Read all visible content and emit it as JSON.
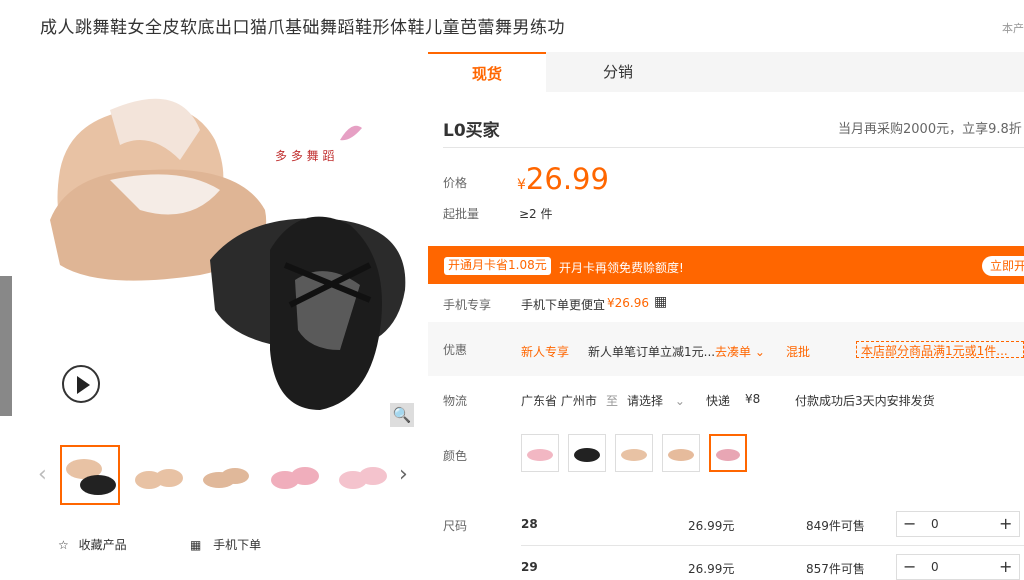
{
  "title": "成人跳舞鞋女全皮软底出口猫爪基础舞蹈鞋形体鞋儿童芭蕾舞男练功",
  "top_right": "本产",
  "tabs": [
    "现货",
    "分销"
  ],
  "buyer_level": "L0买家",
  "buyer_tip": "当月再采购2000元，立享9.8折",
  "price_label": "价格",
  "price_currency": "¥",
  "price": "26.99",
  "moq_label": "起批量",
  "moq": "≥2 件",
  "banner": {
    "tag": "开通月卡省1.08元",
    "text": "开月卡再领免费赊额度!",
    "button": "立即开"
  },
  "mobile": {
    "label": "手机专享",
    "text": "手机下单更便宜",
    "price": "¥26.96"
  },
  "promo": {
    "label": "优惠",
    "new": "新人专享",
    "desc": "新人单笔订单立减1元...",
    "go": "去凑单",
    "mix": "混批",
    "store": "本店部分商品满1元或1件..."
  },
  "logistics": {
    "label": "物流",
    "from": "广东省 广州市",
    "to": "至",
    "select": "请选择",
    "method": "快递",
    "fee": "¥8",
    "ship": "付款成功后3天内安排发货"
  },
  "color_label": "颜色",
  "size_label": "尺码",
  "sizes": [
    {
      "size": "28",
      "price": "26.99元",
      "stock": "849件可售",
      "qty": "0"
    },
    {
      "size": "29",
      "price": "26.99元",
      "stock": "857件可售",
      "qty": "0"
    }
  ],
  "gallery": {
    "brand": "多 多 舞 蹈",
    "collect": "收藏产品",
    "mobile_order": "手机下单"
  },
  "colors": {
    "accent": "#ff6600",
    "pink": "#e8a6b4",
    "beige": "#e8c2a4",
    "black": "#222222"
  }
}
